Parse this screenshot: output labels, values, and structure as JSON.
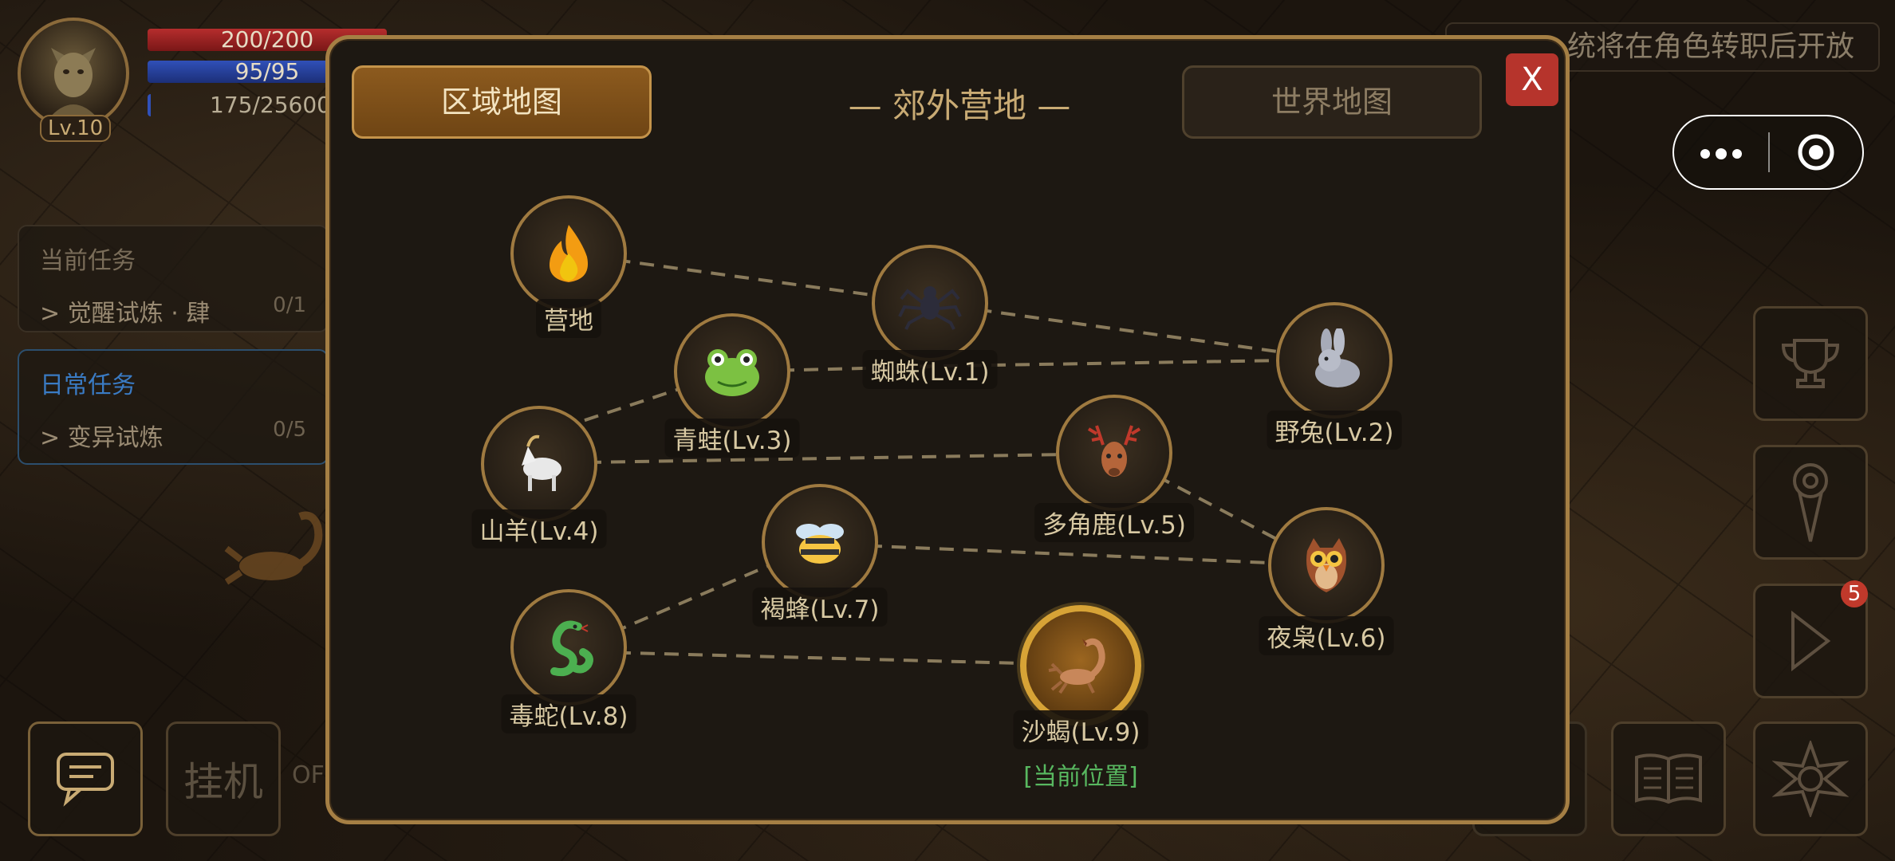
{
  "hud": {
    "level": "Lv.10",
    "hp": "200/200",
    "mp": "95/95",
    "exp": "175/25600",
    "notice": "统将在角色转职后开放",
    "badge_count": "5"
  },
  "quests": {
    "current": {
      "title": "当前任务",
      "item": "> 觉醒试炼 · 肆",
      "count": "0/1"
    },
    "daily": {
      "title": "日常任务",
      "item": "> 变异试炼",
      "count": "0/5"
    }
  },
  "bottom": {
    "idle_label": "挂机",
    "off_label": "OF"
  },
  "map": {
    "tab_region": "区域地图",
    "tab_world": "世界地图",
    "title": "— 郊外营地 —",
    "close": "X",
    "current_tag": "[当前位置]",
    "nodes": [
      {
        "label": "营地",
        "icon": "fire-icon"
      },
      {
        "label": "蜘蛛(Lv.1)",
        "icon": "spider-icon"
      },
      {
        "label": "野兔(Lv.2)",
        "icon": "rabbit-icon"
      },
      {
        "label": "青蛙(Lv.3)",
        "icon": "frog-icon"
      },
      {
        "label": "山羊(Lv.4)",
        "icon": "goat-icon"
      },
      {
        "label": "多角鹿(Lv.5)",
        "icon": "deer-icon"
      },
      {
        "label": "夜枭(Lv.6)",
        "icon": "owl-icon"
      },
      {
        "label": "褐蜂(Lv.7)",
        "icon": "bee-icon"
      },
      {
        "label": "毒蛇(Lv.8)",
        "icon": "snake-icon"
      },
      {
        "label": "沙蝎(Lv.9)",
        "icon": "scorpion-icon"
      }
    ]
  },
  "colors": {
    "accent": "#c9ab74",
    "border": "#a57f44",
    "current": "#d7a336",
    "close": "#b6342c",
    "current_tag": "#58b860"
  }
}
